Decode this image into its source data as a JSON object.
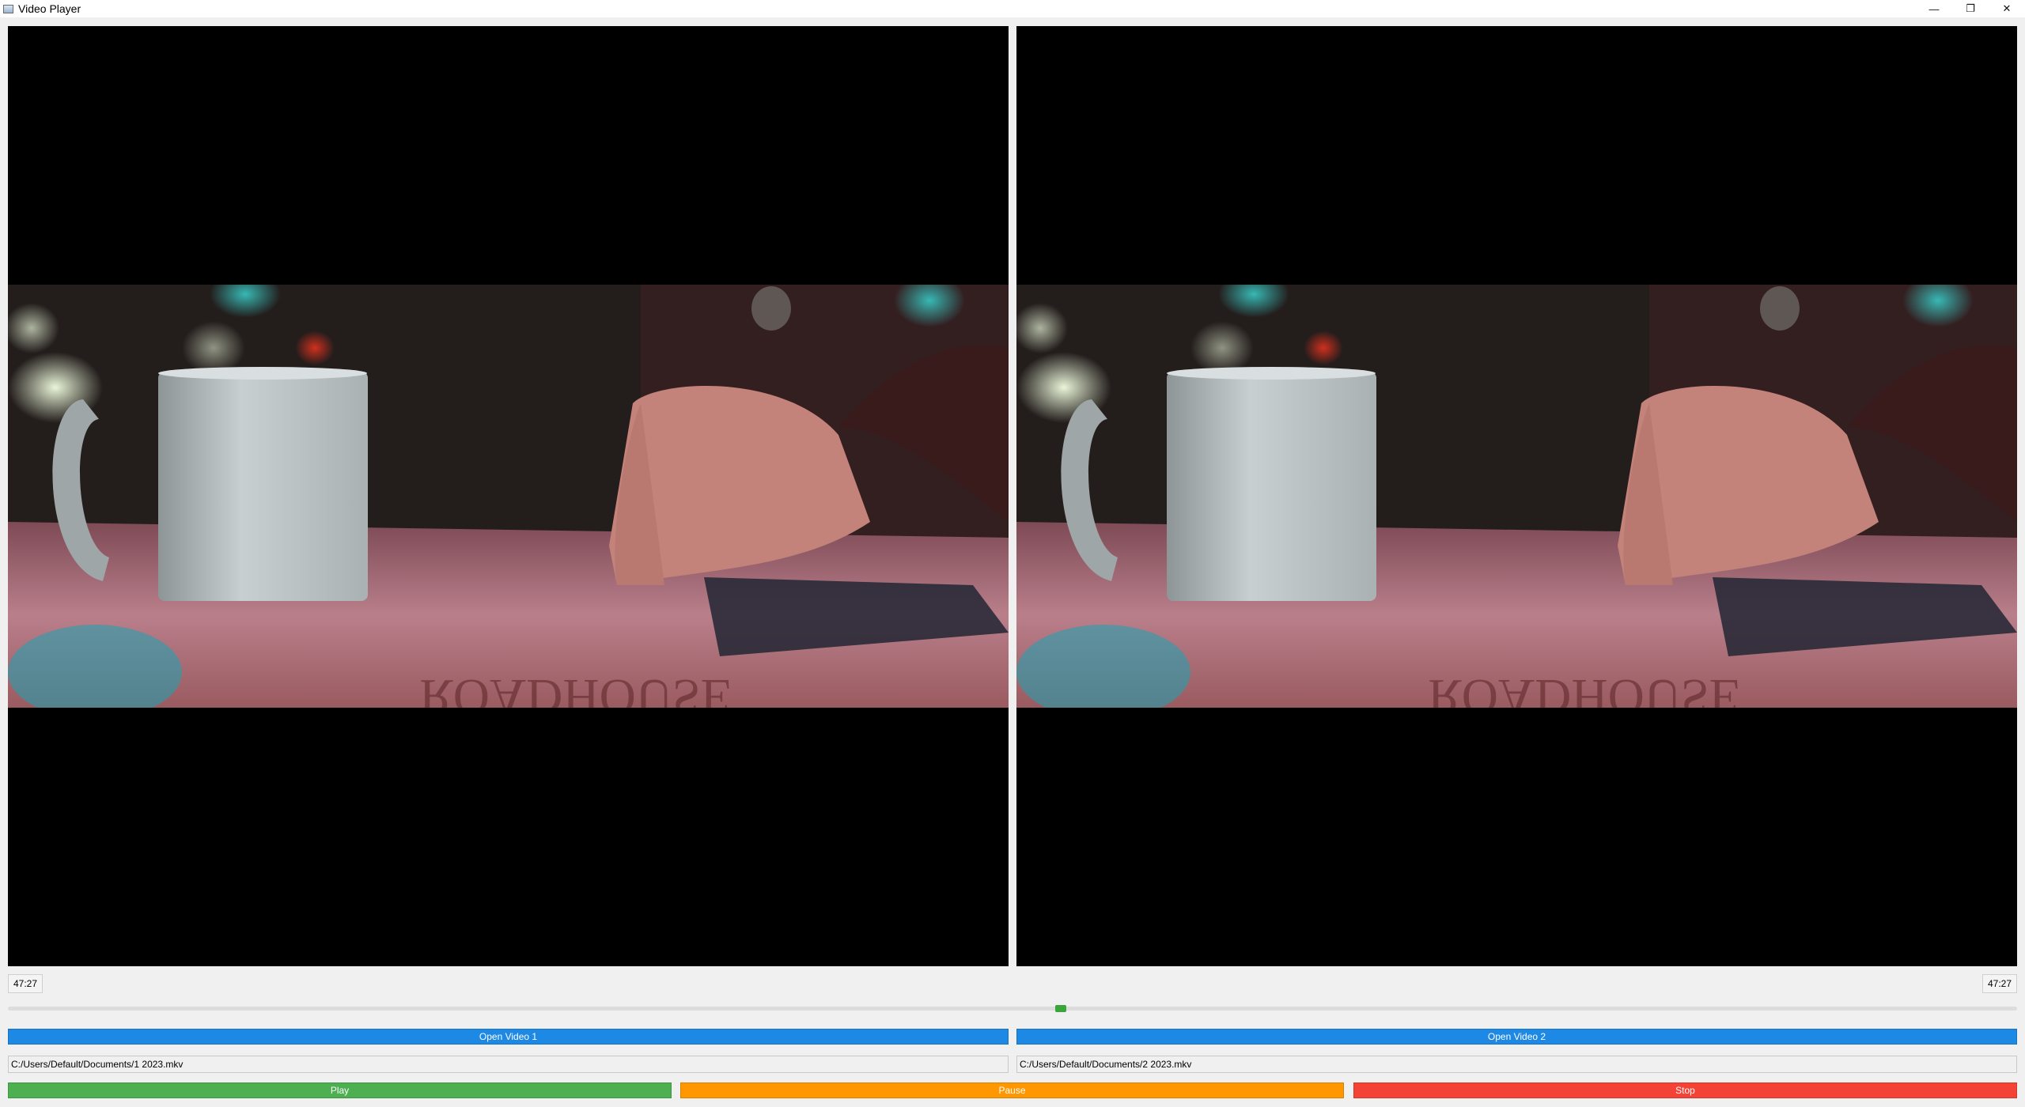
{
  "window": {
    "title": "Video Player",
    "controls": {
      "minimize": "—",
      "restore": "❐",
      "close": "✕"
    }
  },
  "videos": [
    {
      "time": "47:27",
      "open_label": "Open Video 1",
      "path": "C:/Users/Default/Documents/1 2023.mkv"
    },
    {
      "time": "47:27",
      "open_label": "Open Video 2",
      "path": "C:/Users/Default/Documents/2 2023.mkv"
    }
  ],
  "seek": {
    "position_fraction": 0.524
  },
  "controls": {
    "play_label": "Play",
    "pause_label": "Pause",
    "stop_label": "Stop"
  },
  "colors": {
    "open_button": "#1e88e5",
    "play_button": "#4caf50",
    "pause_button": "#ff9800",
    "stop_button": "#f44336",
    "slider_handle": "#3aa53a"
  },
  "icons": {
    "app": "window-app-icon"
  }
}
